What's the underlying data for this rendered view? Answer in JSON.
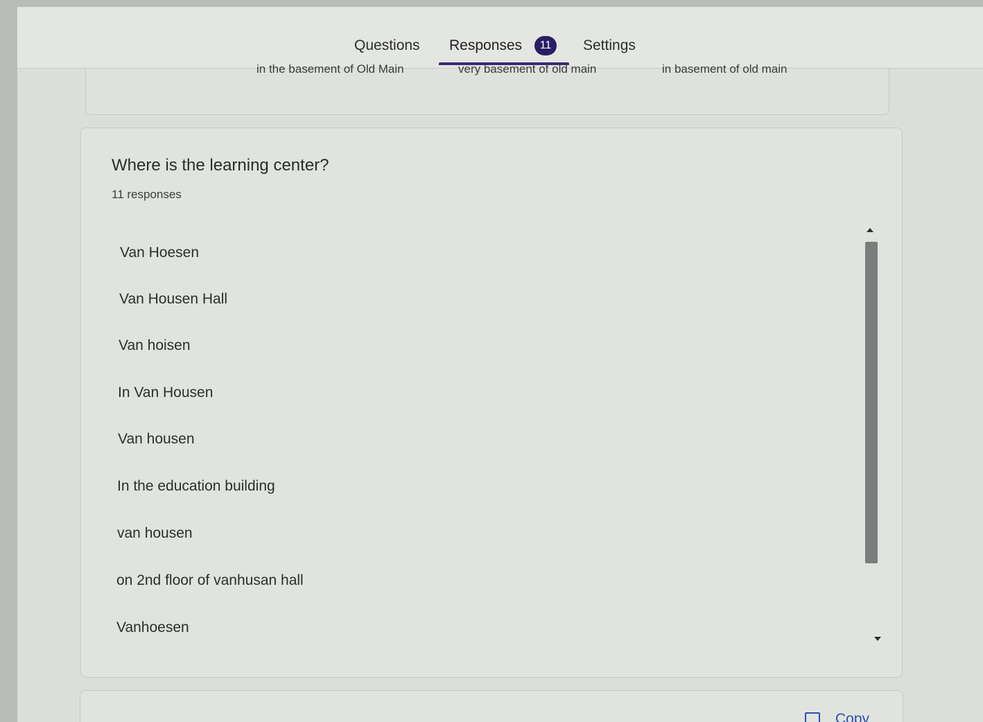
{
  "tabs": {
    "questions": "Questions",
    "responses": "Responses",
    "responses_count": "11",
    "settings": "Settings"
  },
  "previous_card": {
    "answers": [
      "in the basement of Old Main",
      "very basement of old main",
      "in basement of old main"
    ]
  },
  "question": {
    "title": "Where is the learning center?",
    "count_label": "11 responses",
    "responses": [
      "Van Hoesen",
      "Van Housen Hall",
      "Van hoisen",
      "In Van Housen",
      "Van housen",
      "In the education building",
      "van housen",
      "on 2nd floor of vanhusan hall",
      "Vanhoesen"
    ]
  },
  "next_card": {
    "copy_label": "Copy"
  },
  "colors": {
    "accent": "#3a2a78",
    "badge": "#2a1d64",
    "link": "#2d4fb0"
  }
}
